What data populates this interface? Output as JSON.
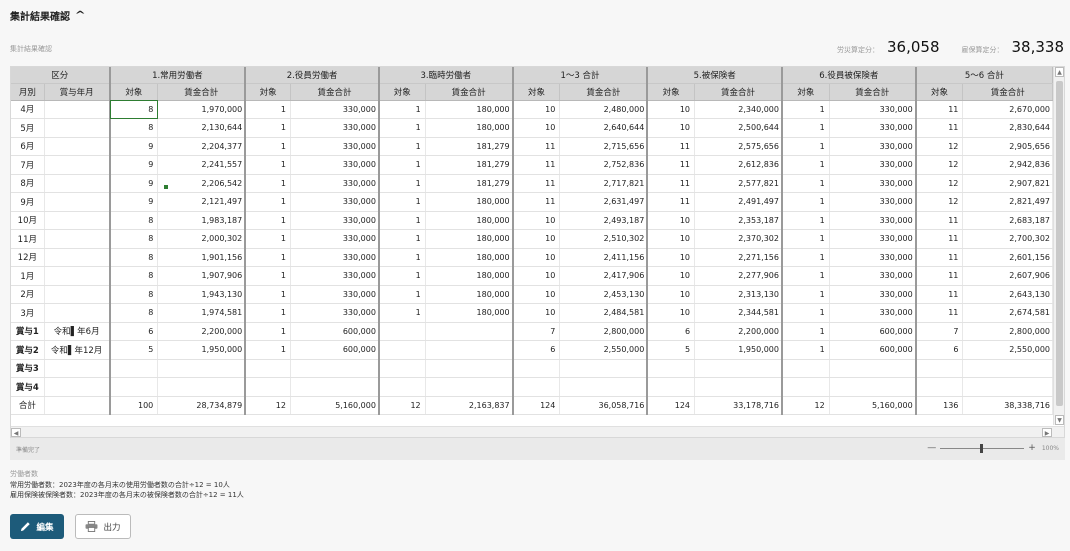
{
  "header": {
    "title": "集計結果確認"
  },
  "subtitle": "集計結果確認",
  "totals": {
    "label1": "労災算定分：",
    "value1": "36,058",
    "label2": "雇保算定分：",
    "value2": "38,338"
  },
  "table": {
    "group_headers": [
      "区分",
      "1.常用労働者",
      "2.役員労働者",
      "3.臨時労働者",
      "1〜3 合計",
      "5.被保険者",
      "6.役員被保険者",
      "5〜6 合計"
    ],
    "sub_headers": [
      "月別",
      "賞与年月",
      "対象",
      "賃金合計",
      "対象",
      "賃金合計",
      "対象",
      "賃金合計",
      "対象",
      "賃金合計",
      "対象",
      "賃金合計",
      "対象",
      "賃金合計",
      "対象",
      "賃金合計"
    ],
    "rows": [
      [
        "4月",
        "",
        "8",
        "1,970,000",
        "1",
        "330,000",
        "1",
        "180,000",
        "10",
        "2,480,000",
        "10",
        "2,340,000",
        "1",
        "330,000",
        "11",
        "2,670,000"
      ],
      [
        "5月",
        "",
        "8",
        "2,130,644",
        "1",
        "330,000",
        "1",
        "180,000",
        "10",
        "2,640,644",
        "10",
        "2,500,644",
        "1",
        "330,000",
        "11",
        "2,830,644"
      ],
      [
        "6月",
        "",
        "9",
        "2,204,377",
        "1",
        "330,000",
        "1",
        "181,279",
        "11",
        "2,715,656",
        "11",
        "2,575,656",
        "1",
        "330,000",
        "12",
        "2,905,656"
      ],
      [
        "7月",
        "",
        "9",
        "2,241,557",
        "1",
        "330,000",
        "1",
        "181,279",
        "11",
        "2,752,836",
        "11",
        "2,612,836",
        "1",
        "330,000",
        "12",
        "2,942,836"
      ],
      [
        "8月",
        "",
        "9",
        "2,206,542",
        "1",
        "330,000",
        "1",
        "181,279",
        "11",
        "2,717,821",
        "11",
        "2,577,821",
        "1",
        "330,000",
        "12",
        "2,907,821"
      ],
      [
        "9月",
        "",
        "9",
        "2,121,497",
        "1",
        "330,000",
        "1",
        "180,000",
        "11",
        "2,631,497",
        "11",
        "2,491,497",
        "1",
        "330,000",
        "12",
        "2,821,497"
      ],
      [
        "10月",
        "",
        "8",
        "1,983,187",
        "1",
        "330,000",
        "1",
        "180,000",
        "10",
        "2,493,187",
        "10",
        "2,353,187",
        "1",
        "330,000",
        "11",
        "2,683,187"
      ],
      [
        "11月",
        "",
        "8",
        "2,000,302",
        "1",
        "330,000",
        "1",
        "180,000",
        "10",
        "2,510,302",
        "10",
        "2,370,302",
        "1",
        "330,000",
        "11",
        "2,700,302"
      ],
      [
        "12月",
        "",
        "8",
        "1,901,156",
        "1",
        "330,000",
        "1",
        "180,000",
        "10",
        "2,411,156",
        "10",
        "2,271,156",
        "1",
        "330,000",
        "11",
        "2,601,156"
      ],
      [
        "1月",
        "",
        "8",
        "1,907,906",
        "1",
        "330,000",
        "1",
        "180,000",
        "10",
        "2,417,906",
        "10",
        "2,277,906",
        "1",
        "330,000",
        "11",
        "2,607,906"
      ],
      [
        "2月",
        "",
        "8",
        "1,943,130",
        "1",
        "330,000",
        "1",
        "180,000",
        "10",
        "2,453,130",
        "10",
        "2,313,130",
        "1",
        "330,000",
        "11",
        "2,643,130"
      ],
      [
        "3月",
        "",
        "8",
        "1,974,581",
        "1",
        "330,000",
        "1",
        "180,000",
        "10",
        "2,484,581",
        "10",
        "2,344,581",
        "1",
        "330,000",
        "11",
        "2,674,581"
      ],
      [
        "賞与1",
        "令和▌年6月",
        "6",
        "2,200,000",
        "1",
        "600,000",
        "",
        "",
        "7",
        "2,800,000",
        "6",
        "2,200,000",
        "1",
        "600,000",
        "7",
        "2,800,000"
      ],
      [
        "賞与2",
        "令和▌年12月",
        "5",
        "1,950,000",
        "1",
        "600,000",
        "",
        "",
        "6",
        "2,550,000",
        "5",
        "1,950,000",
        "1",
        "600,000",
        "6",
        "2,550,000"
      ],
      [
        "賞与3",
        "",
        "",
        "",
        "",
        "",
        "",
        "",
        "",
        "",
        "",
        "",
        "",
        "",
        "",
        ""
      ],
      [
        "賞与4",
        "",
        "",
        "",
        "",
        "",
        "",
        "",
        "",
        "",
        "",
        "",
        "",
        "",
        "",
        ""
      ],
      [
        "合計",
        "",
        "100",
        "28,734,879",
        "12",
        "5,160,000",
        "12",
        "2,163,837",
        "124",
        "36,058,716",
        "124",
        "33,178,716",
        "12",
        "5,160,000",
        "136",
        "38,338,716"
      ]
    ]
  },
  "status": {
    "text": "準備完了",
    "zoom_minus": "—",
    "zoom_plus": "+",
    "zoom_pct": "100%"
  },
  "notes": {
    "heading": "労働者数",
    "line1": "常用労働者数：2023年度の各月末の使用労働者数の合計÷12 = 10人",
    "line2": "雇用保険被保険者数：2023年度の各月末の被保険者数の合計÷12 = 11人"
  },
  "buttons": {
    "edit": "編集",
    "print": "出力"
  },
  "icons": {
    "collapse": "chevron-up-icon",
    "edit": "pencil-icon",
    "print": "printer-icon"
  },
  "colors": {
    "edit_button": "#1d5b7a",
    "header_bg": "#d6d6d6",
    "selection": "#2e7d32"
  }
}
